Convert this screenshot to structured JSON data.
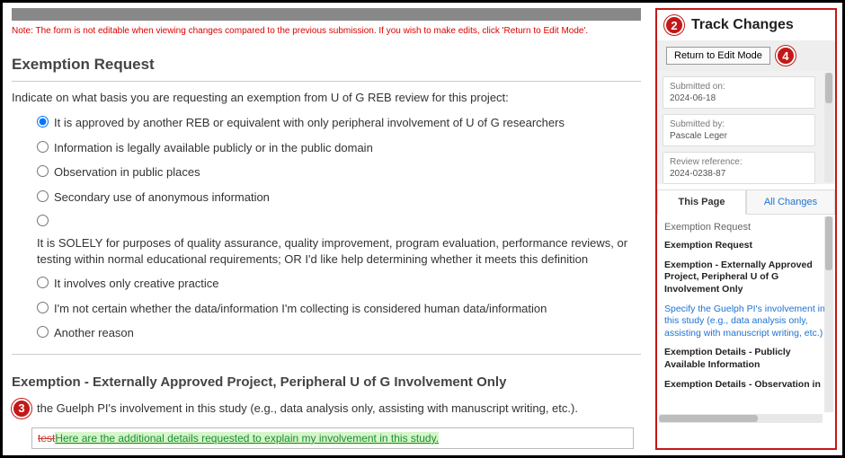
{
  "note": "Note: The form is not editable when viewing changes compared to the previous submission. If you wish to make edits, click 'Return to Edit Mode'.",
  "section1": {
    "title": "Exemption Request",
    "prompt": "Indicate on what basis you are requesting an exemption from U of G REB review for this project:",
    "options": [
      "It is approved by another REB or equivalent with only peripheral involvement of U of G researchers",
      "Information is legally available publicly or in the public domain",
      "Observation in public places",
      "Secondary use of anonymous information",
      "",
      "It involves only creative practice",
      "I'm not certain whether the data/information I'm collecting is considered human data/information",
      "Another reason"
    ],
    "solely": "It is SOLELY for purposes of quality assurance, quality improvement, program evaluation, performance reviews, or testing within normal educational requirements; OR I'd like help determining whether it meets this definition",
    "selectedIndex": 0
  },
  "section2": {
    "title": "Exemption - Externally Approved Project, Peripheral U of G Involvement Only",
    "prompt_suffix": "the Guelph PI's involvement in this study (e.g., data analysis only, assisting with manuscript writing, etc.).",
    "field_old": "test",
    "field_new": "Here are the additional details requested to explain my involvement in this study."
  },
  "panel": {
    "title": "Track Changes",
    "return": "Return to Edit Mode",
    "meta": {
      "submitted_on_label": "Submitted on:",
      "submitted_on": "2024-06-18",
      "submitted_by_label": "Submitted by:",
      "submitted_by": "Pascale Leger",
      "review_ref_label": "Review reference:",
      "review_ref": "2024-0238-87"
    },
    "tabs": {
      "thispage": "This Page",
      "all": "All Changes"
    },
    "list": {
      "header": "Exemption Request",
      "items": [
        "Exemption Request",
        "Exemption - Externally Approved Project, Peripheral U of G Involvement Only",
        "Specify the Guelph PI's involvement in this study (e.g., data analysis only, assisting with manuscript writing, etc.)",
        "Exemption Details - Publicly Available Information",
        "Exemption Details - Observation in"
      ]
    }
  },
  "badges": {
    "b2": "2",
    "b3": "3",
    "b4": "4"
  }
}
